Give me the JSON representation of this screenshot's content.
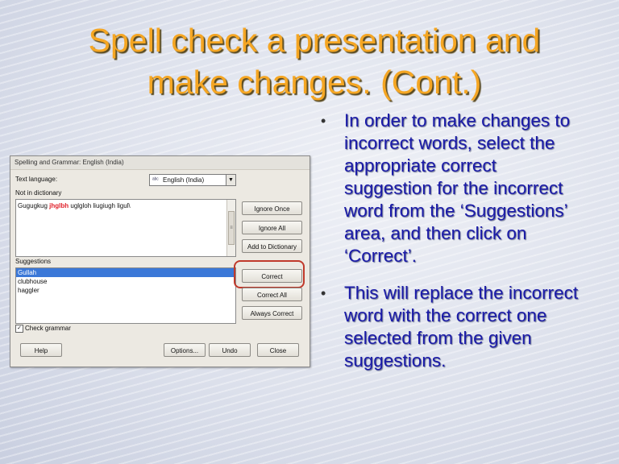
{
  "slide": {
    "title_line1": "Spell check a presentation and",
    "title_line2": "make changes. (Cont.)",
    "title_color": "#f5a623",
    "bullet_color": "#1a1aa8",
    "bullets": [
      "In order to make changes to incorrect words, select the appropriate correct suggestion for the incorrect word from the ‘Suggestions’ area, and then click on ‘Correct’.",
      "This will replace the incorrect word with the correct one selected from the given suggestions."
    ]
  },
  "dialog": {
    "title": "Spelling and Grammar: English (India)",
    "text_language_label": "Text language:",
    "language_value": "English (India)",
    "not_in_dictionary_label": "Not in dictionary",
    "sentence_before": "Gugugkug ",
    "error_word": "jhglbh",
    "sentence_after": " uglgloh liugiugh ligul\\",
    "suggestions_label": "Suggestions",
    "suggestions": [
      "Gullah",
      "clubhouse",
      "haggler"
    ],
    "selected_suggestion_index": 0,
    "check_grammar_label": "Check grammar",
    "check_grammar_checked": true,
    "buttons": {
      "ignore_once": "Ignore Once",
      "ignore_all": "Ignore All",
      "add_to_dictionary": "Add to Dictionary",
      "correct": "Correct",
      "correct_all": "Correct All",
      "always_correct": "Always Correct",
      "help": "Help",
      "options": "Options...",
      "undo": "Undo",
      "close": "Close"
    },
    "highlight_color": "#c0392b",
    "selection_color": "#3b78d8"
  }
}
